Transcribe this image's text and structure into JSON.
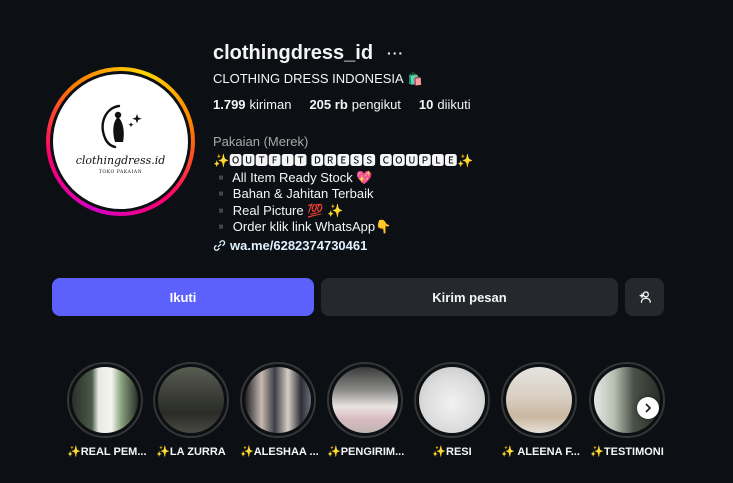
{
  "profile": {
    "username": "clothingdress_id",
    "more_label": "···",
    "full_name": "CLOTHING DRESS INDONESIA",
    "full_name_emoji": "🛍️",
    "avatar_text": "clothingdress.id",
    "avatar_subtext": "TOKO PAKAIAN",
    "stats": {
      "posts_count": "1.799",
      "posts_label": "kiriman",
      "followers_count": "205 rb",
      "followers_label": "pengikut",
      "following_count": "10",
      "following_label": "diikuti"
    },
    "category": "Pakaian (Merek)",
    "bio": [
      "✨🅾🆄🆃🅵🅸🆃 🅳🆁🅴🆂🆂 🅲🅾🆄🅿🅻🅴✨",
      "▪️ All Item Ready Stock 💖",
      "▪️ Bahan & Jahitan Terbaik",
      "▪️ Real Picture 💯 ✨",
      "▪️ Order klik link WhatsApp👇"
    ],
    "link": "wa.me/6282374730461"
  },
  "buttons": {
    "follow": "Ikuti",
    "message": "Kirim pesan"
  },
  "highlights": [
    {
      "label": "✨REAL PEM..."
    },
    {
      "label": "✨LA ZURRA"
    },
    {
      "label": "✨ALESHAA ..."
    },
    {
      "label": "✨PENGIRIM..."
    },
    {
      "label": "✨RESI"
    },
    {
      "label": "✨ ALEENA F..."
    },
    {
      "label": "✨TESTIMONI"
    }
  ],
  "icons": {
    "link": "link-icon",
    "add_user": "add-user-icon",
    "next": "chevron-right-icon"
  },
  "colors": {
    "background": "#0c1014",
    "follow_button": "#5b61fa",
    "secondary_button": "#25292e",
    "link": "#e0f1ff",
    "muted": "#a8a8a8"
  }
}
